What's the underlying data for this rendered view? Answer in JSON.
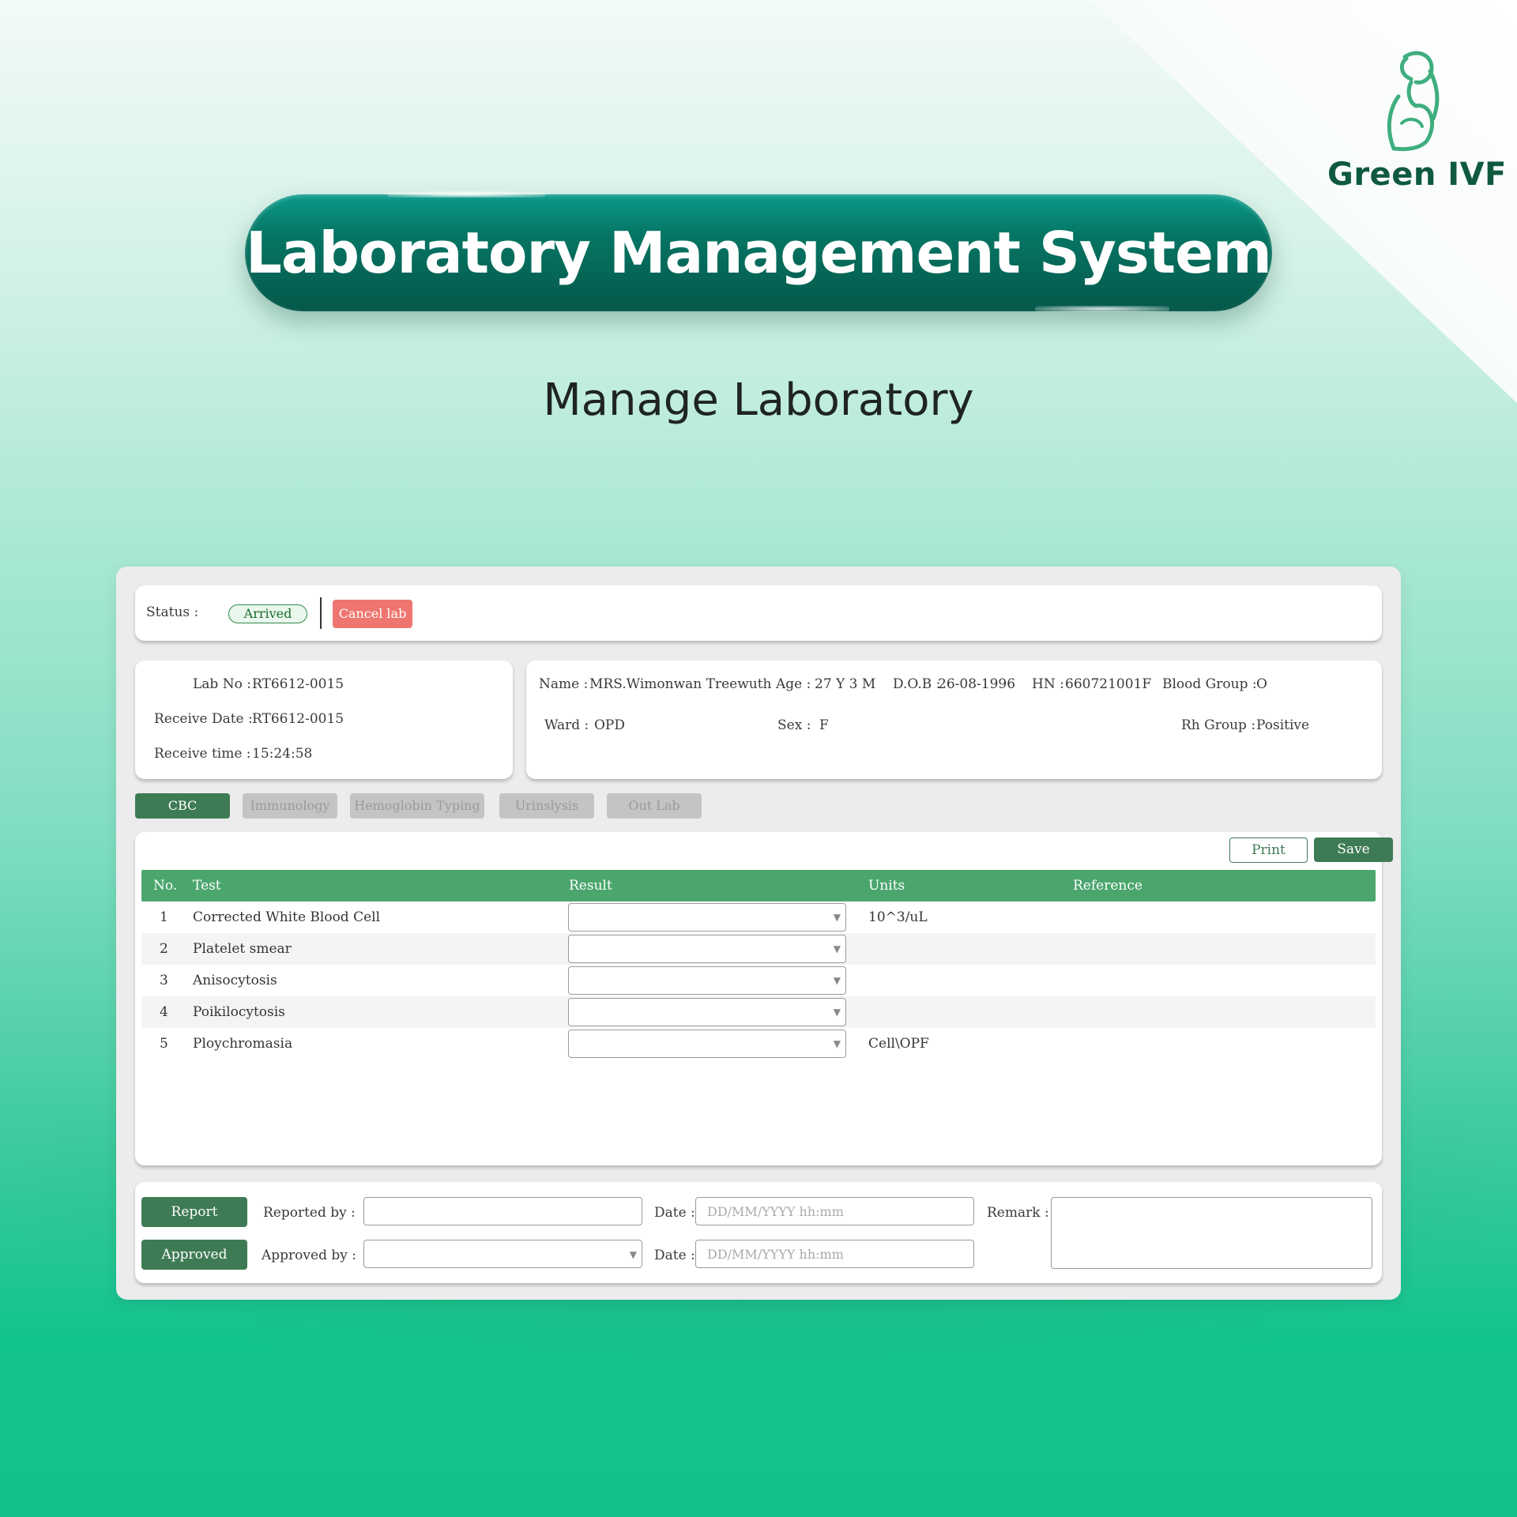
{
  "brand": {
    "name": "Green IVF",
    "logo_icon": "pregnant-woman-icon",
    "color": "#0f5a3e"
  },
  "banner": {
    "title": "Laboratory Management System"
  },
  "subtitle": "Manage Laboratory",
  "status": {
    "label": "Status :",
    "value": "Arrived",
    "cancel_label": "Cancel lab"
  },
  "lab_info": {
    "lab_no_label": "Lab No :",
    "lab_no": "RT6612-0015",
    "receive_date_label": "Receive Date :",
    "receive_date": "RT6612-0015",
    "receive_time_label": "Receive time :",
    "receive_time": "15:24:58"
  },
  "patient": {
    "name_label": "Name :",
    "name": "MRS.Wimonwan Treewuth",
    "age_label": "Age :",
    "age": "27 Y 3 M",
    "dob_label": "D.O.B :",
    "dob": "26-08-1996",
    "hn_label": "HN :",
    "hn": "660721001F",
    "blood_group_label": "Blood Group :",
    "blood_group": "O",
    "ward_label": "Ward :",
    "ward": "OPD",
    "sex_label": "Sex :",
    "sex": "F",
    "rh_group_label": "Rh Group :",
    "rh_group": "Positive"
  },
  "tabs": [
    {
      "label": "CBC",
      "active": true
    },
    {
      "label": "Immunology",
      "active": false
    },
    {
      "label": "Hemoglobin Typing",
      "active": false
    },
    {
      "label": "Urinslysis",
      "active": false
    },
    {
      "label": "Out Lab",
      "active": false
    }
  ],
  "actions": {
    "print_label": "Print",
    "save_label": "Save"
  },
  "table": {
    "headers": {
      "no": "No.",
      "test": "Test",
      "result": "Result",
      "units": "Units",
      "reference": "Reference"
    },
    "rows": [
      {
        "no": "1",
        "test": "Corrected White Blood Cell",
        "result": "",
        "units": "10^3/uL",
        "reference": ""
      },
      {
        "no": "2",
        "test": "Platelet smear",
        "result": "",
        "units": "",
        "reference": ""
      },
      {
        "no": "3",
        "test": "Anisocytosis",
        "result": "",
        "units": "",
        "reference": ""
      },
      {
        "no": "4",
        "test": "Poikilocytosis",
        "result": "",
        "units": "",
        "reference": ""
      },
      {
        "no": "5",
        "test": "Ploychromasia",
        "result": "",
        "units": "Cell\\OPF",
        "reference": ""
      }
    ]
  },
  "report": {
    "report_button": "Report",
    "approved_button": "Approved",
    "reported_by_label": "Reported by :",
    "approved_by_label": "Approved by :",
    "date_label": "Date :",
    "date_placeholder": "DD/MM/YYYY hh:mm",
    "remark_label": "Remark :"
  },
  "colors": {
    "accent": "#3e7b54",
    "table_header": "#4ba66e",
    "cancel": "#ef7670",
    "banner": "#05584a"
  }
}
